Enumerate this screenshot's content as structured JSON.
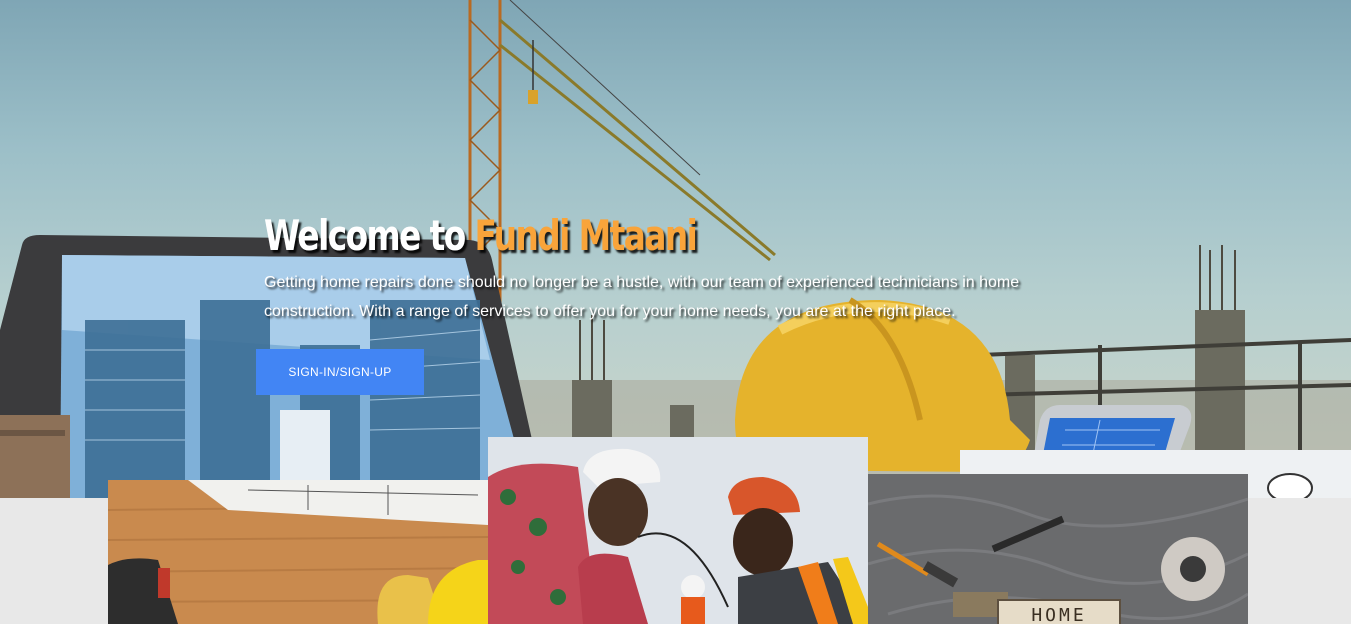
{
  "hero": {
    "title_prefix": "Welcome to",
    "title_brand": "Fundi Mtaani",
    "description": "Getting home repairs done should no longer be a hustle, with our team of experienced technicians in home construction. With a range of services to offer you for your home needs, you are at the right place.",
    "cta_label": "SIGN-IN/SIGN-UP",
    "background_scene": "construction-site-with-crane-laptop-and-hard-hat"
  },
  "gallery": [
    {
      "image": "workbench-with-blueprints-and-hard-hat"
    },
    {
      "image": "construction-workers-in-hard-hats"
    },
    {
      "image": "tools-on-plastic-sheet-with-home-sign",
      "sign_text": "HOME"
    }
  ],
  "colors": {
    "brand_accent": "#f9a43a",
    "button": "#4285f4",
    "page_background": "#e8e8e8"
  }
}
